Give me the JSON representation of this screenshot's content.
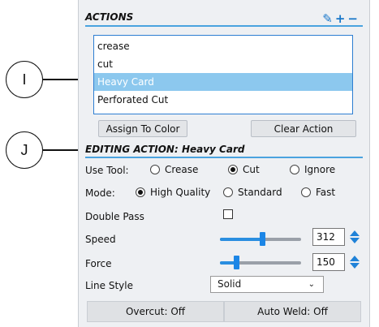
{
  "callouts": [
    {
      "label": "I"
    },
    {
      "label": "J"
    }
  ],
  "actions": {
    "title": "ACTIONS",
    "icons": [
      "pencil-icon",
      "plus-icon",
      "minus-icon"
    ],
    "items": [
      {
        "label": "crease",
        "selected": false
      },
      {
        "label": "cut",
        "selected": false
      },
      {
        "label": "Heavy Card",
        "selected": true
      },
      {
        "label": "Perforated Cut",
        "selected": false
      }
    ],
    "assign_button": "Assign To Color",
    "clear_button": "Clear Action"
  },
  "editing": {
    "title": "EDITING ACTION: Heavy Card",
    "use_tool": {
      "label": "Use Tool:",
      "options": [
        "Crease",
        "Cut",
        "Ignore"
      ],
      "selected": "Cut"
    },
    "mode": {
      "label": "Mode:",
      "options": [
        "High Quality",
        "Standard",
        "Fast"
      ],
      "selected": "High Quality"
    },
    "double_pass": {
      "label": "Double Pass",
      "checked": false
    },
    "speed": {
      "label": "Speed",
      "value": "312",
      "slider_fraction": 0.52
    },
    "force": {
      "label": "Force",
      "value": "150",
      "slider_fraction": 0.2
    },
    "line_style": {
      "label": "Line Style",
      "value": "Solid"
    },
    "overcut": "Overcut: Off",
    "auto_weld": "Auto Weld: Off"
  },
  "colors": {
    "accent": "#2a8ee0",
    "selection": "#8cc8ee",
    "panel_bg": "#eef0f3"
  }
}
